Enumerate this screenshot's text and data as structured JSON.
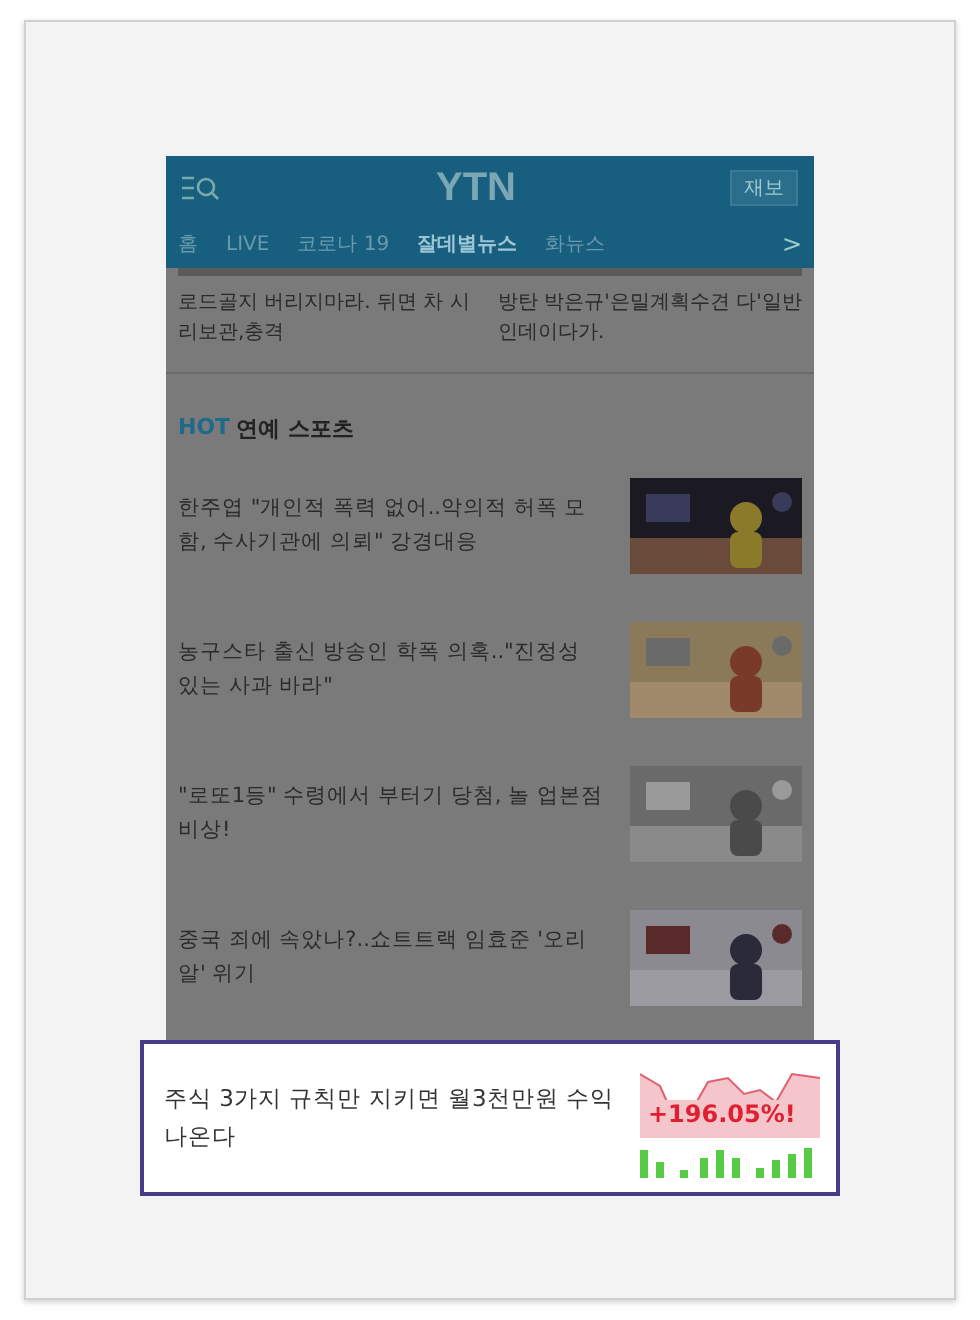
{
  "header": {
    "logo": "YTN",
    "button": "재보"
  },
  "nav": {
    "tabs": [
      {
        "label": "홈",
        "selected": false
      },
      {
        "label": "LIVE",
        "selected": false
      },
      {
        "label": "코로나 19",
        "selected": false
      },
      {
        "label": "잘데별뉴스",
        "selected": true
      },
      {
        "label": "화뉴스",
        "selected": false
      }
    ],
    "more": ">"
  },
  "top_articles": [
    "로드골지 버리지마라. 뒤면 차 시리보관,충격",
    "방탄 박은규'은밀계획수견 다'일반인데이다가."
  ],
  "section": {
    "badge": "HOT",
    "title": "연예 스포츠"
  },
  "articles": [
    {
      "title": "한주엽 \"개인적 폭력 없어..악의적 허폭 모함, 수사기관에 의뢰\" 강경대응",
      "kind": "picture"
    },
    {
      "title": "농구스타 출신 방송인 학폭 의혹..\"진정성 있는 사과 바라\"",
      "kind": "picture"
    },
    {
      "title": "\"로또1등\" 수령에서 부터기 당첨, 놀 업본점 비상!",
      "kind": "picture"
    },
    {
      "title": "중국 죄에 속았나?..쇼트트랙 임효준 '오리알' 위기",
      "kind": "picture"
    }
  ],
  "ad": {
    "text": "주식 3가지 규칙만 지키면 월3천만원 수익 나온다",
    "figure": "+196.05%!"
  }
}
